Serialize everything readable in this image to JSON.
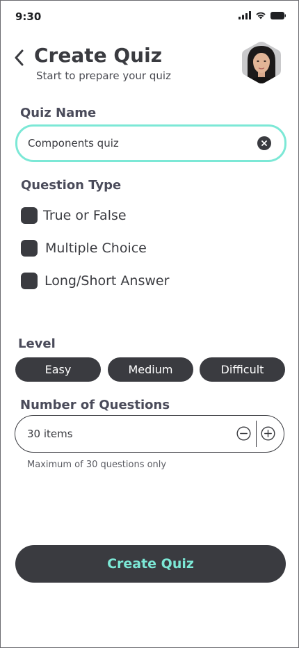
{
  "status_bar": {
    "time": "9:30",
    "icons": [
      "signal-icon",
      "wifi-icon",
      "battery-icon"
    ]
  },
  "header": {
    "title": "Create Quiz",
    "subtitle": "Start to prepare your quiz",
    "back_icon": "chevron-left-icon",
    "avatar_icon": "user-avatar"
  },
  "quiz_name": {
    "label": "Quiz Name",
    "value": "Components quiz",
    "clear_icon": "clear-icon"
  },
  "question_type": {
    "label": "Question Type",
    "options": [
      {
        "label": "True or False",
        "checked": false
      },
      {
        "label": "Multiple Choice",
        "checked": false
      },
      {
        "label": "Long/Short Answer",
        "checked": false
      }
    ]
  },
  "level": {
    "label": "Level",
    "options": [
      "Easy",
      "Medium",
      "Difficult"
    ]
  },
  "number_of_questions": {
    "label": "Number of Questions",
    "value": "30 items",
    "hint": "Maximum of 30 questions only",
    "decrement_icon": "minus-circle-icon",
    "increment_icon": "plus-circle-icon"
  },
  "create_button": {
    "label": "Create Quiz"
  },
  "colors": {
    "accent": "#7ce8d6",
    "dark": "#3a3b40",
    "background": "#ffffff"
  }
}
